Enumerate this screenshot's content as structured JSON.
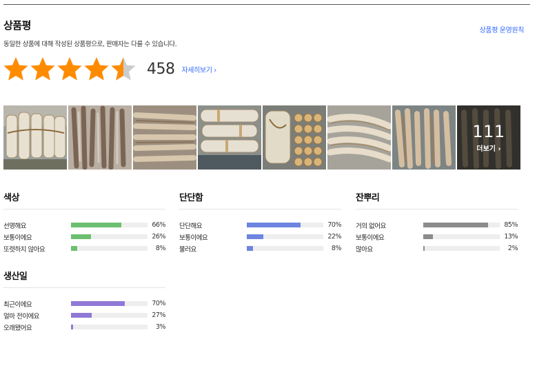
{
  "header": {
    "title": "상품평",
    "policy_link": "상품평 운영원칙",
    "notice": "동일한 상품에 대해 작성된 상품평으로, 판매자는 다를 수 있습니다."
  },
  "rating": {
    "stars": 4.5,
    "max_stars": 5,
    "star_icon": "star-icon",
    "review_count": "458",
    "more_link": "자세히보기 ›"
  },
  "photos": {
    "visible_count": 8,
    "more_count": "111",
    "more_label": "더보기 ›"
  },
  "colors": {
    "star": "#ff8c00",
    "star_empty": "#cccccc",
    "link": "#346aff",
    "bar_green": "#6cbf6f",
    "bar_blue": "#6d85e0",
    "bar_gray": "#8c8c8c",
    "bar_purple": "#8f78d6"
  },
  "surveys": [
    {
      "title": "색상",
      "color": "#6cbf6f",
      "options": [
        {
          "label": "선명해요",
          "value": 66,
          "pct": "66%"
        },
        {
          "label": "보통이에요",
          "value": 26,
          "pct": "26%"
        },
        {
          "label": "또렷하지 않아요",
          "value": 8,
          "pct": "8%"
        }
      ]
    },
    {
      "title": "단단함",
      "color": "#6d85e0",
      "options": [
        {
          "label": "단단해요",
          "value": 70,
          "pct": "70%"
        },
        {
          "label": "보통이에요",
          "value": 22,
          "pct": "22%"
        },
        {
          "label": "물러요",
          "value": 8,
          "pct": "8%"
        }
      ]
    },
    {
      "title": "잔뿌리",
      "color": "#8c8c8c",
      "options": [
        {
          "label": "거의 없어요",
          "value": 85,
          "pct": "85%"
        },
        {
          "label": "보통이에요",
          "value": 13,
          "pct": "13%"
        },
        {
          "label": "많아요",
          "value": 2,
          "pct": "2%"
        }
      ]
    },
    {
      "title": "생산일",
      "color": "#8f78d6",
      "options": [
        {
          "label": "최근이에요",
          "value": 70,
          "pct": "70%"
        },
        {
          "label": "얼마 전이에요",
          "value": 27,
          "pct": "27%"
        },
        {
          "label": "오래됐어요",
          "value": 3,
          "pct": "3%"
        }
      ]
    }
  ]
}
